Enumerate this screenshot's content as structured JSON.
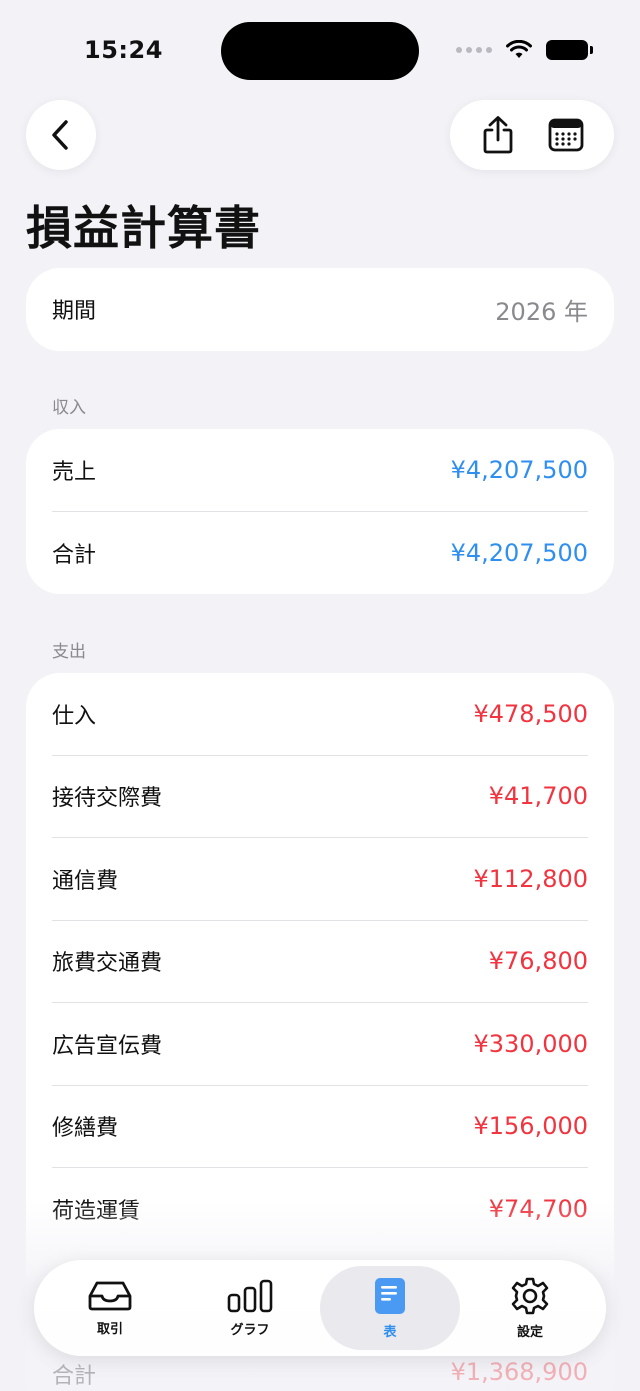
{
  "status_bar": {
    "time": "15:24"
  },
  "page": {
    "title": "損益計算書"
  },
  "period": {
    "label": "期間",
    "value": "2026 年"
  },
  "income": {
    "section_label": "収入",
    "rows": [
      {
        "label": "売上",
        "value": "¥4,207,500"
      },
      {
        "label": "合計",
        "value": "¥4,207,500"
      }
    ]
  },
  "expense": {
    "section_label": "支出",
    "rows": [
      {
        "label": "仕入",
        "value": "¥478,500"
      },
      {
        "label": "接待交際費",
        "value": "¥41,700"
      },
      {
        "label": "通信費",
        "value": "¥112,800"
      },
      {
        "label": "旅費交通費",
        "value": "¥76,800"
      },
      {
        "label": "広告宣伝費",
        "value": "¥330,000"
      },
      {
        "label": "修繕費",
        "value": "¥156,000"
      },
      {
        "label": "荷造運賃",
        "value": "¥74,700"
      }
    ],
    "total": {
      "label": "合計",
      "value": "¥1,368,900"
    }
  },
  "tabbar": {
    "tabs": [
      {
        "label": "取引",
        "icon": "inbox-tray-icon"
      },
      {
        "label": "グラフ",
        "icon": "bar-chart-icon"
      },
      {
        "label": "表",
        "icon": "document-icon"
      },
      {
        "label": "設定",
        "icon": "gear-icon"
      }
    ],
    "active_index": 2
  },
  "colors": {
    "background": "#f2f2f7",
    "income": "#2f8ff0",
    "expense": "#f1343f",
    "accent": "#2f8ff0"
  }
}
